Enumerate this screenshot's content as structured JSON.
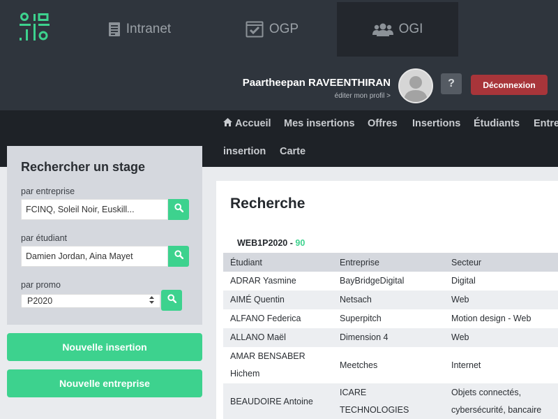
{
  "header": {
    "apps": [
      {
        "label": "Intranet",
        "icon": "document-icon"
      },
      {
        "label": "OGP",
        "icon": "checkbox-window-icon"
      },
      {
        "label": "OGI",
        "icon": "users-icon",
        "active": true
      }
    ],
    "user": {
      "name": "Paartheepan RAVEENTHIRAN",
      "edit_profile": "éditer mon profil >"
    },
    "help_label": "?",
    "logout_label": "Déconnexion"
  },
  "nav": {
    "items": [
      {
        "label": "Accueil",
        "icon": "home-icon"
      },
      {
        "label": "Mes insertions"
      },
      {
        "label": "Offres"
      },
      {
        "label": "Insertions"
      },
      {
        "label": "Étudiants"
      },
      {
        "label": "Entre"
      },
      {
        "label": "insertion"
      },
      {
        "label": "Carte"
      }
    ]
  },
  "search": {
    "title": "Rechercher un stage",
    "by_company_label": "par entreprise",
    "by_company_value": "FCINQ, Soleil Noir, Euskill...",
    "by_student_label": "par étudiant",
    "by_student_value": "Damien Jordan, Aina Mayet",
    "by_promo_label": "par promo",
    "by_promo_value": "P2020"
  },
  "actions": {
    "new_insertion": "Nouvelle insertion",
    "new_company": "Nouvelle entreprise"
  },
  "results": {
    "title": "Recherche",
    "promo": "WEB1P2020",
    "separator": " - ",
    "count": "90",
    "columns": [
      "Étudiant",
      "Entreprise",
      "Secteur"
    ],
    "rows": [
      [
        "ADRAR Yasmine",
        "BayBridgeDigital",
        "Digital"
      ],
      [
        "AIMÉ Quentin",
        "Netsach",
        "Web"
      ],
      [
        "ALFANO Federica",
        "Superpitch",
        "Motion design - Web"
      ],
      [
        "ALLANO Maël",
        "Dimension 4",
        "Web"
      ],
      [
        "AMAR BENSABER Hichem",
        "Meetches",
        "Internet"
      ],
      [
        "BEAUDOIRE Antoine",
        "ICARE TECHNOLOGIES",
        "Objets connectés, cybersécurité, bancaire"
      ]
    ]
  },
  "colors": {
    "accent": "#3dd28e",
    "danger": "#a8353a",
    "header_bg": "#2f353d",
    "nav_bg": "#1e2227"
  }
}
